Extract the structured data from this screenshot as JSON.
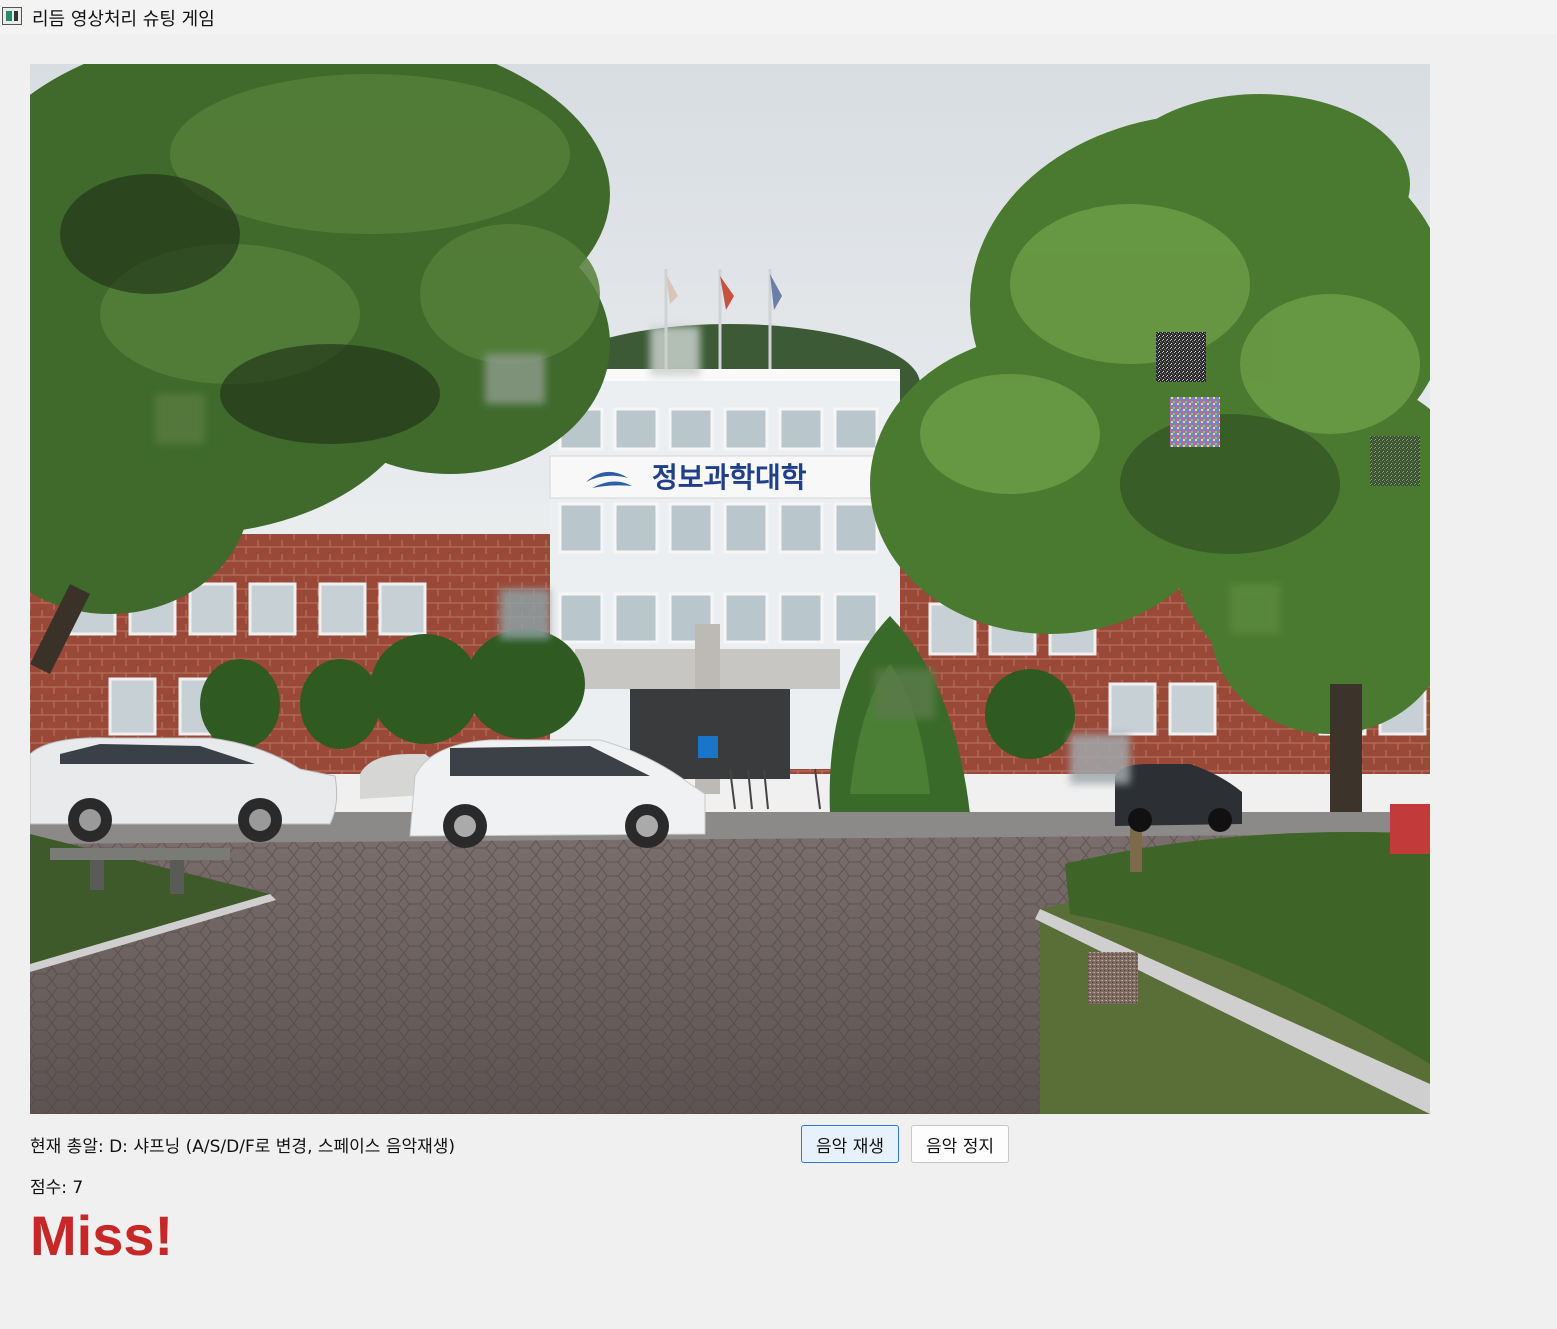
{
  "window": {
    "title": "리듬 영상처리 슈팅 게임",
    "icon": "app-window-icon"
  },
  "scene": {
    "sign_text": "정보과학대학",
    "description_icon": "campus-building-photo"
  },
  "hud": {
    "status": "현재 총알: D: 샤프닝 (A/S/D/F로 변경, 스페이스 음악재생)",
    "score": "점수: 7",
    "judgement": "Miss!"
  },
  "buttons": {
    "play_label": "음악 재생",
    "stop_label": "음악 정지"
  },
  "colors": {
    "judgement": "#c62828",
    "play_button_border": "#2a7ad6",
    "background": "#f0f0f0"
  }
}
